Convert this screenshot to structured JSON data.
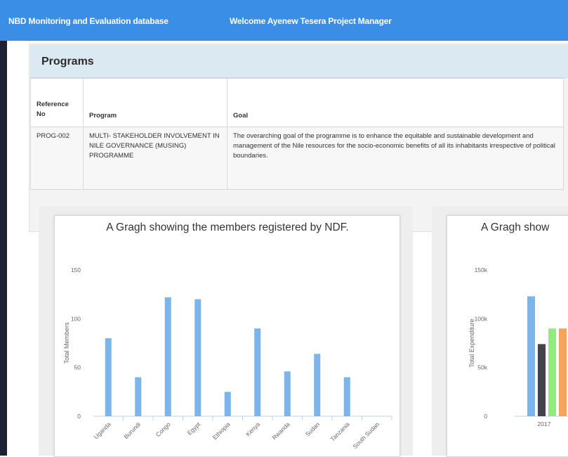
{
  "header": {
    "app_title": "NBD Monitoring and Evaluation database",
    "welcome_text": "Welcome Ayenew Tesera  Project Manager",
    "bar_color": "#3a8ee6"
  },
  "programs_panel": {
    "title": "Programs",
    "columns": [
      "Reference No",
      "Program",
      "Goal"
    ],
    "rows": [
      {
        "ref": "PROG-002",
        "program": "MULTI- STAKEHOLDER INVOLVEMENT IN NILE GOVERNANCE (MUSING) PROGRAMME",
        "goal": "The overarching goal of the programme is to enhance the equitable and sustainable development and management of the Nile resources for the socio-economic benefits of all its inhabitants irrespective of political boundaries."
      }
    ]
  },
  "chart_data": [
    {
      "type": "bar",
      "title": "A Gragh showing the members registered by NDF.",
      "ylabel": "Total Members",
      "xlabel": "",
      "ylim": [
        0,
        150
      ],
      "yticks": [
        "0",
        "50",
        "100",
        "150"
      ],
      "categories": [
        "Uganda",
        "Burundi",
        "Congo",
        "Egypt",
        "Ethiopia",
        "Kenya",
        "Rwanda",
        "Sudan",
        "Tanzania",
        "South Sudan"
      ],
      "values": [
        80,
        40,
        122,
        120,
        25,
        90,
        46,
        64,
        40,
        0
      ],
      "color": "#7cb5ec",
      "grid": false
    },
    {
      "type": "bar",
      "title": "A Gragh show",
      "ylabel": "Total Expenditure",
      "xlabel": "",
      "ylim": [
        0,
        150000
      ],
      "yticks": [
        "0",
        "50k",
        "100k",
        "150k"
      ],
      "categories": [
        "2017"
      ],
      "series": [
        {
          "values": [
            123000
          ],
          "color": "#7cb5ec"
        },
        {
          "values": [
            74000
          ],
          "color": "#434348"
        },
        {
          "values": [
            90000
          ],
          "color": "#90ed7d"
        },
        {
          "values": [
            90000
          ],
          "color": "#f7a35c"
        }
      ],
      "grid": false
    }
  ]
}
